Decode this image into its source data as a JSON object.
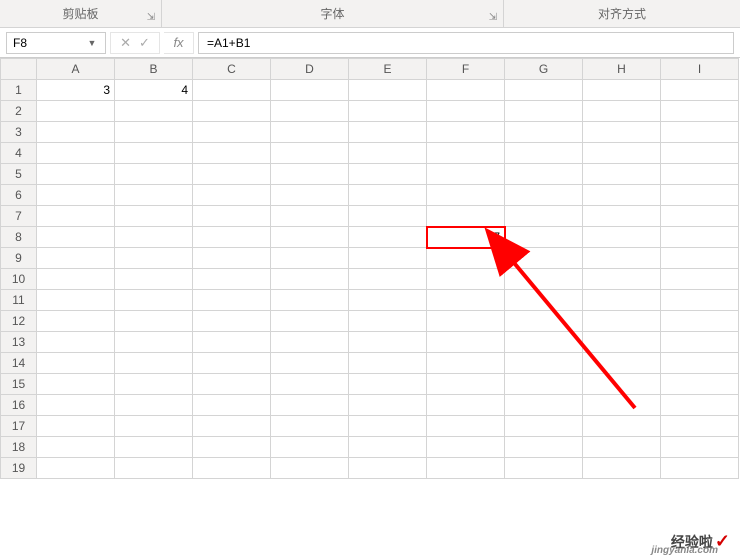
{
  "ribbon": {
    "groups": {
      "clipboard": "剪贴板",
      "font": "字体",
      "alignment": "对齐方式"
    }
  },
  "formula_bar": {
    "cell_reference": "F8",
    "fx_label": "fx",
    "formula": "=A1+B1"
  },
  "columns": [
    "A",
    "B",
    "C",
    "D",
    "E",
    "F",
    "G",
    "H",
    "I"
  ],
  "rows": [
    "1",
    "2",
    "3",
    "4",
    "5",
    "6",
    "7",
    "8",
    "9",
    "10",
    "11",
    "12",
    "13",
    "14",
    "15",
    "16",
    "17",
    "18",
    "19"
  ],
  "cells": {
    "A1": "3",
    "B1": "4",
    "F8": "7"
  },
  "selected_cell": "F8",
  "watermark": {
    "text": "经验啦",
    "url": "jingyanla.com"
  }
}
